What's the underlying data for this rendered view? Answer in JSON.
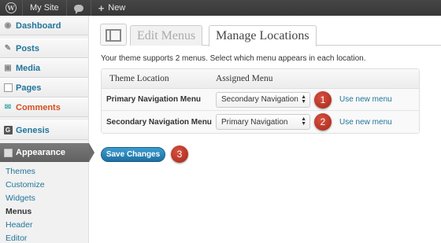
{
  "adminbar": {
    "site_name": "My Site",
    "new_label": "New",
    "wp_logo_icon": "wordpress-logo-icon",
    "comments_icon": "speech-bubble-icon"
  },
  "sidebar": {
    "items": [
      {
        "label": "Dashboard",
        "icon": "dashboard-icon"
      },
      {
        "label": "Posts",
        "icon": "pushpin-icon"
      },
      {
        "label": "Media",
        "icon": "media-icon"
      },
      {
        "label": "Pages",
        "icon": "pages-icon"
      },
      {
        "label": "Comments",
        "icon": "comment-icon"
      },
      {
        "label": "Genesis",
        "icon": "genesis-icon"
      },
      {
        "label": "Appearance",
        "icon": "appearance-icon"
      }
    ],
    "submenu": [
      "Themes",
      "Customize",
      "Widgets",
      "Menus",
      "Header",
      "Editor"
    ]
  },
  "main": {
    "tabs": {
      "edit": "Edit Menus",
      "manage": "Manage Locations"
    },
    "intro": "Your theme supports 2 menus. Select which menu appears in each location.",
    "table": {
      "col_location": "Theme Location",
      "col_assigned": "Assigned Menu",
      "rows": [
        {
          "location": "Primary Navigation Menu",
          "menu": "Secondary Navigation",
          "link": "Use new menu",
          "badge": "1"
        },
        {
          "location": "Secondary Navigation Menu",
          "menu": "Primary Navigation",
          "link": "Use new menu",
          "badge": "2"
        }
      ]
    },
    "save_label": "Save Changes",
    "save_badge": "3"
  },
  "colors": {
    "accent": "#21759b",
    "comments": "#d54e21",
    "button": "#2a86bd",
    "badge": "#c0392b"
  }
}
